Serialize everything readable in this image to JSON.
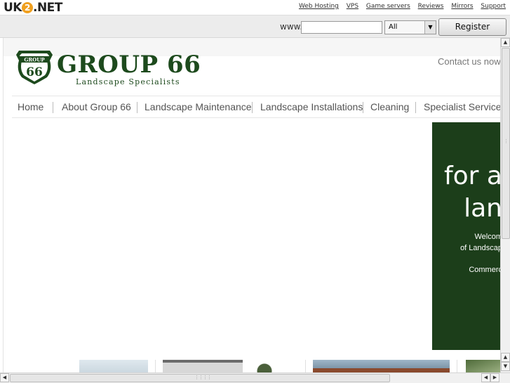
{
  "topbar": {
    "brand_prefix": "UK",
    "brand_two": "2",
    "brand_suffix": ".NET",
    "links": [
      "Web Hosting",
      "VPS",
      "Game servers",
      "Reviews",
      "Mirrors",
      "Support"
    ]
  },
  "domainbar": {
    "www_label": "www.",
    "input_value": "",
    "tld_selected": "All",
    "register_label": "Register Domain"
  },
  "site": {
    "logo": {
      "badge_top": "GROUP",
      "badge_number": "66",
      "title": "GROUP 66",
      "subtitle": "Landscape Specialists"
    },
    "contact_text": "Contact us now",
    "nav": [
      "Home",
      "About Group 66",
      "Landscape Maintenance",
      "Landscape Installations",
      "Cleaning",
      "Specialist Services"
    ],
    "hero": {
      "line1": "for a",
      "line2": "lan",
      "line3": "Welcom",
      "line4": "of Landscap",
      "line5": "Commerc"
    },
    "colors": {
      "brand_green": "#1d4a1d",
      "hero_bg": "#1c3e1a"
    }
  },
  "icons": {
    "scroll_up": "▲",
    "scroll_down": "▼",
    "scroll_left": "◀",
    "scroll_right": "▶",
    "dropdown": "▼"
  }
}
